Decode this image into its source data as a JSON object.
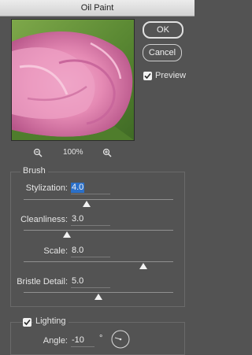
{
  "window": {
    "title": "Oil Paint"
  },
  "buttons": {
    "ok": "OK",
    "cancel": "Cancel"
  },
  "preview_toggle": {
    "label": "Preview",
    "checked": true
  },
  "zoom": {
    "level": "100%"
  },
  "brush": {
    "title": "Brush",
    "stylization": {
      "label": "Stylization:",
      "value": "4.0",
      "slider": 0.42
    },
    "cleanliness": {
      "label": "Cleanliness:",
      "value": "3.0",
      "slider": 0.29
    },
    "scale": {
      "label": "Scale:",
      "value": "8.0",
      "slider": 0.8
    },
    "bristle_detail": {
      "label": "Bristle Detail:",
      "value": "5.0",
      "slider": 0.5
    }
  },
  "lighting": {
    "title": "Lighting",
    "enabled": true,
    "angle": {
      "label": "Angle:",
      "value": "-10",
      "unit": "°"
    }
  }
}
